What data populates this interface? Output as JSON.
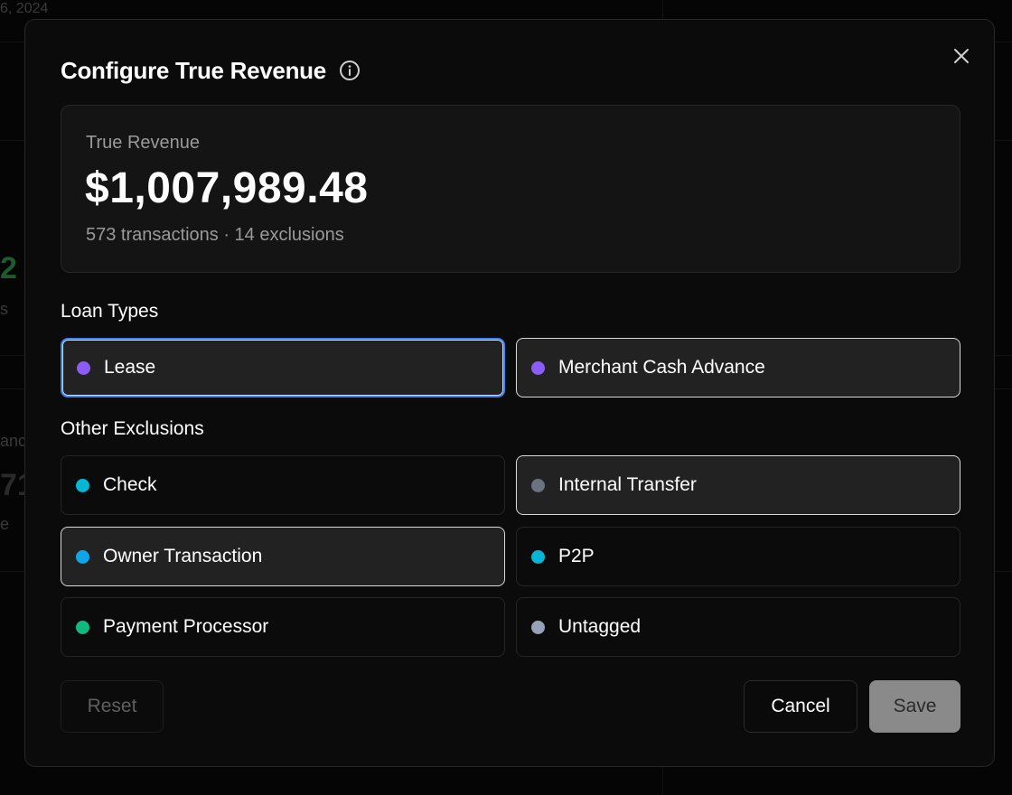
{
  "background": {
    "date_fragment": "6, 2024",
    "green_fragment": "2",
    "s_fragment": "s",
    "anc_fragment": "anc",
    "num_fragment": "71",
    "e_fragment": "e"
  },
  "modal": {
    "title": "Configure True Revenue",
    "info_icon": "info-circle-icon",
    "close_icon": "close-icon"
  },
  "summary": {
    "label": "True Revenue",
    "value": "$1,007,989.48",
    "subtext": "573 transactions · 14 exclusions"
  },
  "loan_types": {
    "label": "Loan Types",
    "options": [
      {
        "label": "Lease",
        "color": "#8b5cf6",
        "state": "focused"
      },
      {
        "label": "Merchant Cash Advance",
        "color": "#8b5cf6",
        "state": "selected"
      }
    ]
  },
  "other_exclusions": {
    "label": "Other Exclusions",
    "options": [
      {
        "label": "Check",
        "color": "#06b6d4",
        "state": "unselected"
      },
      {
        "label": "Internal Transfer",
        "color": "#6b7280",
        "state": "selected"
      },
      {
        "label": "Owner Transaction",
        "color": "#0ea5e9",
        "state": "selected"
      },
      {
        "label": "P2P",
        "color": "#06b6d4",
        "state": "unselected"
      },
      {
        "label": "Payment Processor",
        "color": "#10b981",
        "state": "unselected"
      },
      {
        "label": "Untagged",
        "color": "#94a3b8",
        "state": "unselected"
      }
    ]
  },
  "footer": {
    "reset_label": "Reset",
    "cancel_label": "Cancel",
    "save_label": "Save"
  }
}
